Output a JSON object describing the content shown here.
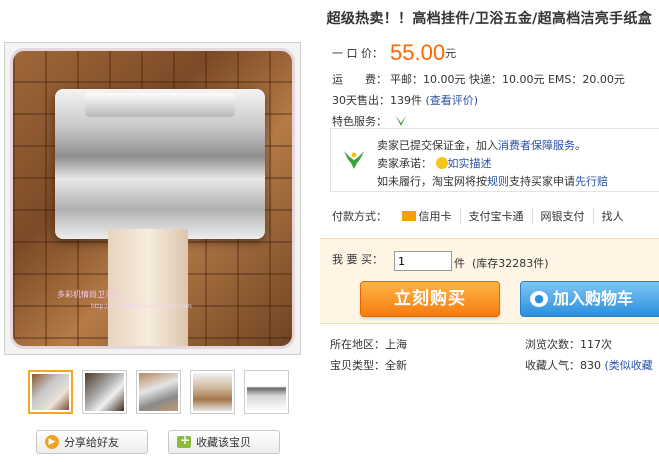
{
  "title": "超级热卖！！高档挂件/卫浴五金/超高档洁亮手纸盒",
  "gallery": {
    "watermark": "多彩机情尚卫浴馆",
    "watermark_url": "http://shop36655556.taobao.com"
  },
  "price": {
    "label": "一 口 价：",
    "value": "55.00",
    "unit": "元"
  },
  "shipping": {
    "label": "运　　费：",
    "text": "平邮：10.00元 快递：10.00元 EMS：20.00元"
  },
  "sales": {
    "label": "30天售出：",
    "value": "139件",
    "link": "(查看评价)"
  },
  "features_label": "特色服务：",
  "service": {
    "line1_prefix": "卖家已提交保证金，加入",
    "line1_link": "消费者保障服务",
    "line1_suffix": "。",
    "line2_label": "卖家承诺：",
    "line2_link": "如实描述",
    "line3_prefix": "如未履行，淘宝网将按",
    "line3_link1": "规则",
    "line3_mid": "支持买家申请",
    "line3_link2": "先行赔"
  },
  "payment": {
    "label": "付款方式：",
    "methods": [
      "信用卡",
      "支付宝卡通",
      "网银支付",
      "找人"
    ]
  },
  "buy": {
    "qty_label": "我 要 买：",
    "qty_value": "1",
    "qty_unit": "件",
    "stock": "(库存32283件)",
    "buy_now": "立刻购买",
    "add_cart": "加入购物车"
  },
  "info": {
    "region_label": "所在地区：",
    "region": "上海",
    "views_label": "浏览次数：",
    "views": "117次",
    "type_label": "宝贝类型：",
    "type": "全新",
    "pop_label": "收藏人气：",
    "pop": "830",
    "pop_link": "(类似收藏"
  },
  "actions": {
    "share": "分享给好友",
    "favorite": "收藏该宝贝"
  },
  "colors": {
    "price": "#ff6600",
    "buy_button": "#f57b10",
    "cart_button": "#2c8fde",
    "link": "#2953a6"
  }
}
